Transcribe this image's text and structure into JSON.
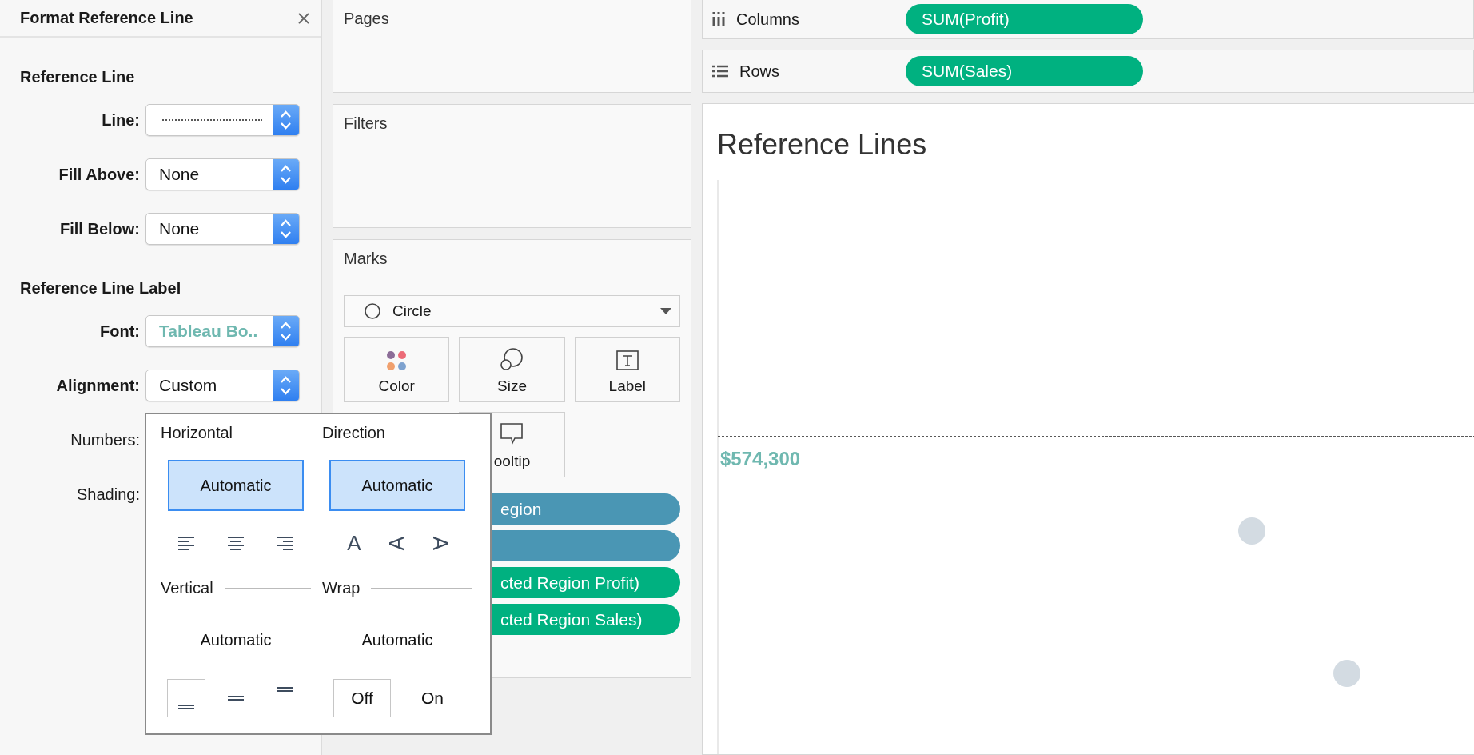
{
  "format_panel": {
    "title": "Format Reference Line",
    "sections": [
      {
        "heading": "Reference Line",
        "fields": [
          {
            "label": "Line:",
            "kind": "line-style"
          },
          {
            "label": "Fill Above:",
            "kind": "select",
            "value": "None"
          },
          {
            "label": "Fill Below:",
            "kind": "select",
            "value": "None"
          }
        ]
      },
      {
        "heading": "Reference Line Label",
        "fields": [
          {
            "label": "Font:",
            "kind": "font",
            "value": "Tableau Bo.."
          },
          {
            "label": "Alignment:",
            "kind": "select",
            "value": "Custom"
          },
          {
            "label": "Numbers:",
            "kind": "covered"
          },
          {
            "label": "Shading:",
            "kind": "covered"
          }
        ]
      }
    ]
  },
  "alignment_popup": {
    "groups": [
      {
        "title": "Horizontal",
        "auto_label": "Automatic",
        "auto_selected": true,
        "options": [
          {
            "kind": "align-left",
            "selected": false
          },
          {
            "kind": "align-center",
            "selected": false
          },
          {
            "kind": "align-right",
            "selected": false
          }
        ]
      },
      {
        "title": "Direction",
        "auto_label": "Automatic",
        "auto_selected": true,
        "options": [
          {
            "kind": "text-up",
            "glyph": "A",
            "selected": false
          },
          {
            "kind": "text-left",
            "glyph": "A",
            "selected": false
          },
          {
            "kind": "text-right",
            "glyph": "A",
            "selected": false
          }
        ]
      },
      {
        "title": "Vertical",
        "auto_label": "Automatic",
        "auto_selected": false,
        "options": [
          {
            "kind": "valign-bottom",
            "selected": true
          },
          {
            "kind": "valign-middle",
            "selected": false
          },
          {
            "kind": "valign-top",
            "selected": false
          }
        ]
      },
      {
        "title": "Wrap",
        "auto_label": "Automatic",
        "auto_selected": false,
        "options": [
          {
            "kind": "text",
            "label": "Off",
            "selected": true
          },
          {
            "kind": "text",
            "label": "On",
            "selected": false
          }
        ]
      }
    ]
  },
  "pages": {
    "title": "Pages"
  },
  "filters": {
    "title": "Filters"
  },
  "marks": {
    "title": "Marks",
    "mark_type": "Circle",
    "cards": [
      {
        "kind": "color",
        "label": "Color"
      },
      {
        "kind": "size",
        "label": "Size"
      },
      {
        "kind": "label",
        "label": "Label"
      },
      {
        "kind": "tooltip",
        "label": "ooltip"
      }
    ],
    "pills": [
      {
        "text": "egion",
        "color": "#4a96b4"
      },
      {
        "color": "#4a96b4"
      },
      {
        "text": "cted Region Profit)",
        "color": "#00b180"
      },
      {
        "text": "cted Region Sales)",
        "color": "#00b180"
      }
    ]
  },
  "shelves": [
    {
      "kind": "columns",
      "label": "Columns",
      "pill": "SUM(Profit)"
    },
    {
      "kind": "rows",
      "label": "Rows",
      "pill": "SUM(Sales)"
    }
  ],
  "view": {
    "title": "Reference Lines",
    "reference_label": "$574,300"
  }
}
